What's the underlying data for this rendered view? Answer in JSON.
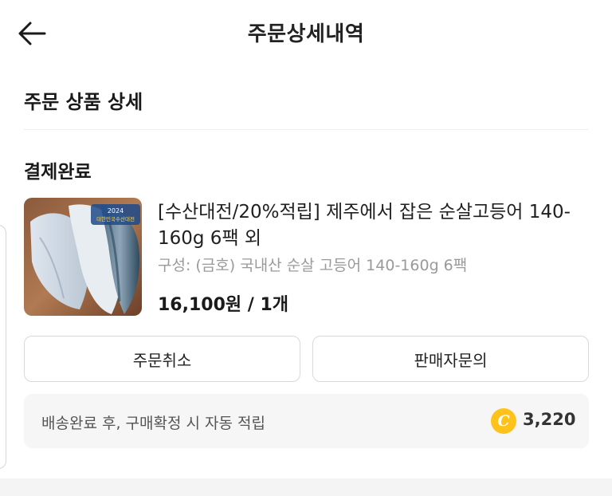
{
  "header": {
    "title": "주문상세내역",
    "back_icon": "arrow-left-icon"
  },
  "section": {
    "title": "주문 상품 상세"
  },
  "order": {
    "status": "결제완료",
    "product": {
      "name": "[수산대전/20%적립] 제주에서 잡은 순살고등어 140-160g 6팩 외",
      "option": "구성: (금호) 국내산 순살 고등어 140-160g 6팩",
      "price": "16,100원 / 1개",
      "image_badge_text": "2024 대한민국수산대전"
    }
  },
  "actions": {
    "cancel_label": "주문취소",
    "inquiry_label": "판매자문의"
  },
  "reward": {
    "text": "배송완료 후, 구매확정 시 자동 적립",
    "coin_symbol": "C",
    "amount": "3,220",
    "coin_color": "#ffc21a"
  }
}
